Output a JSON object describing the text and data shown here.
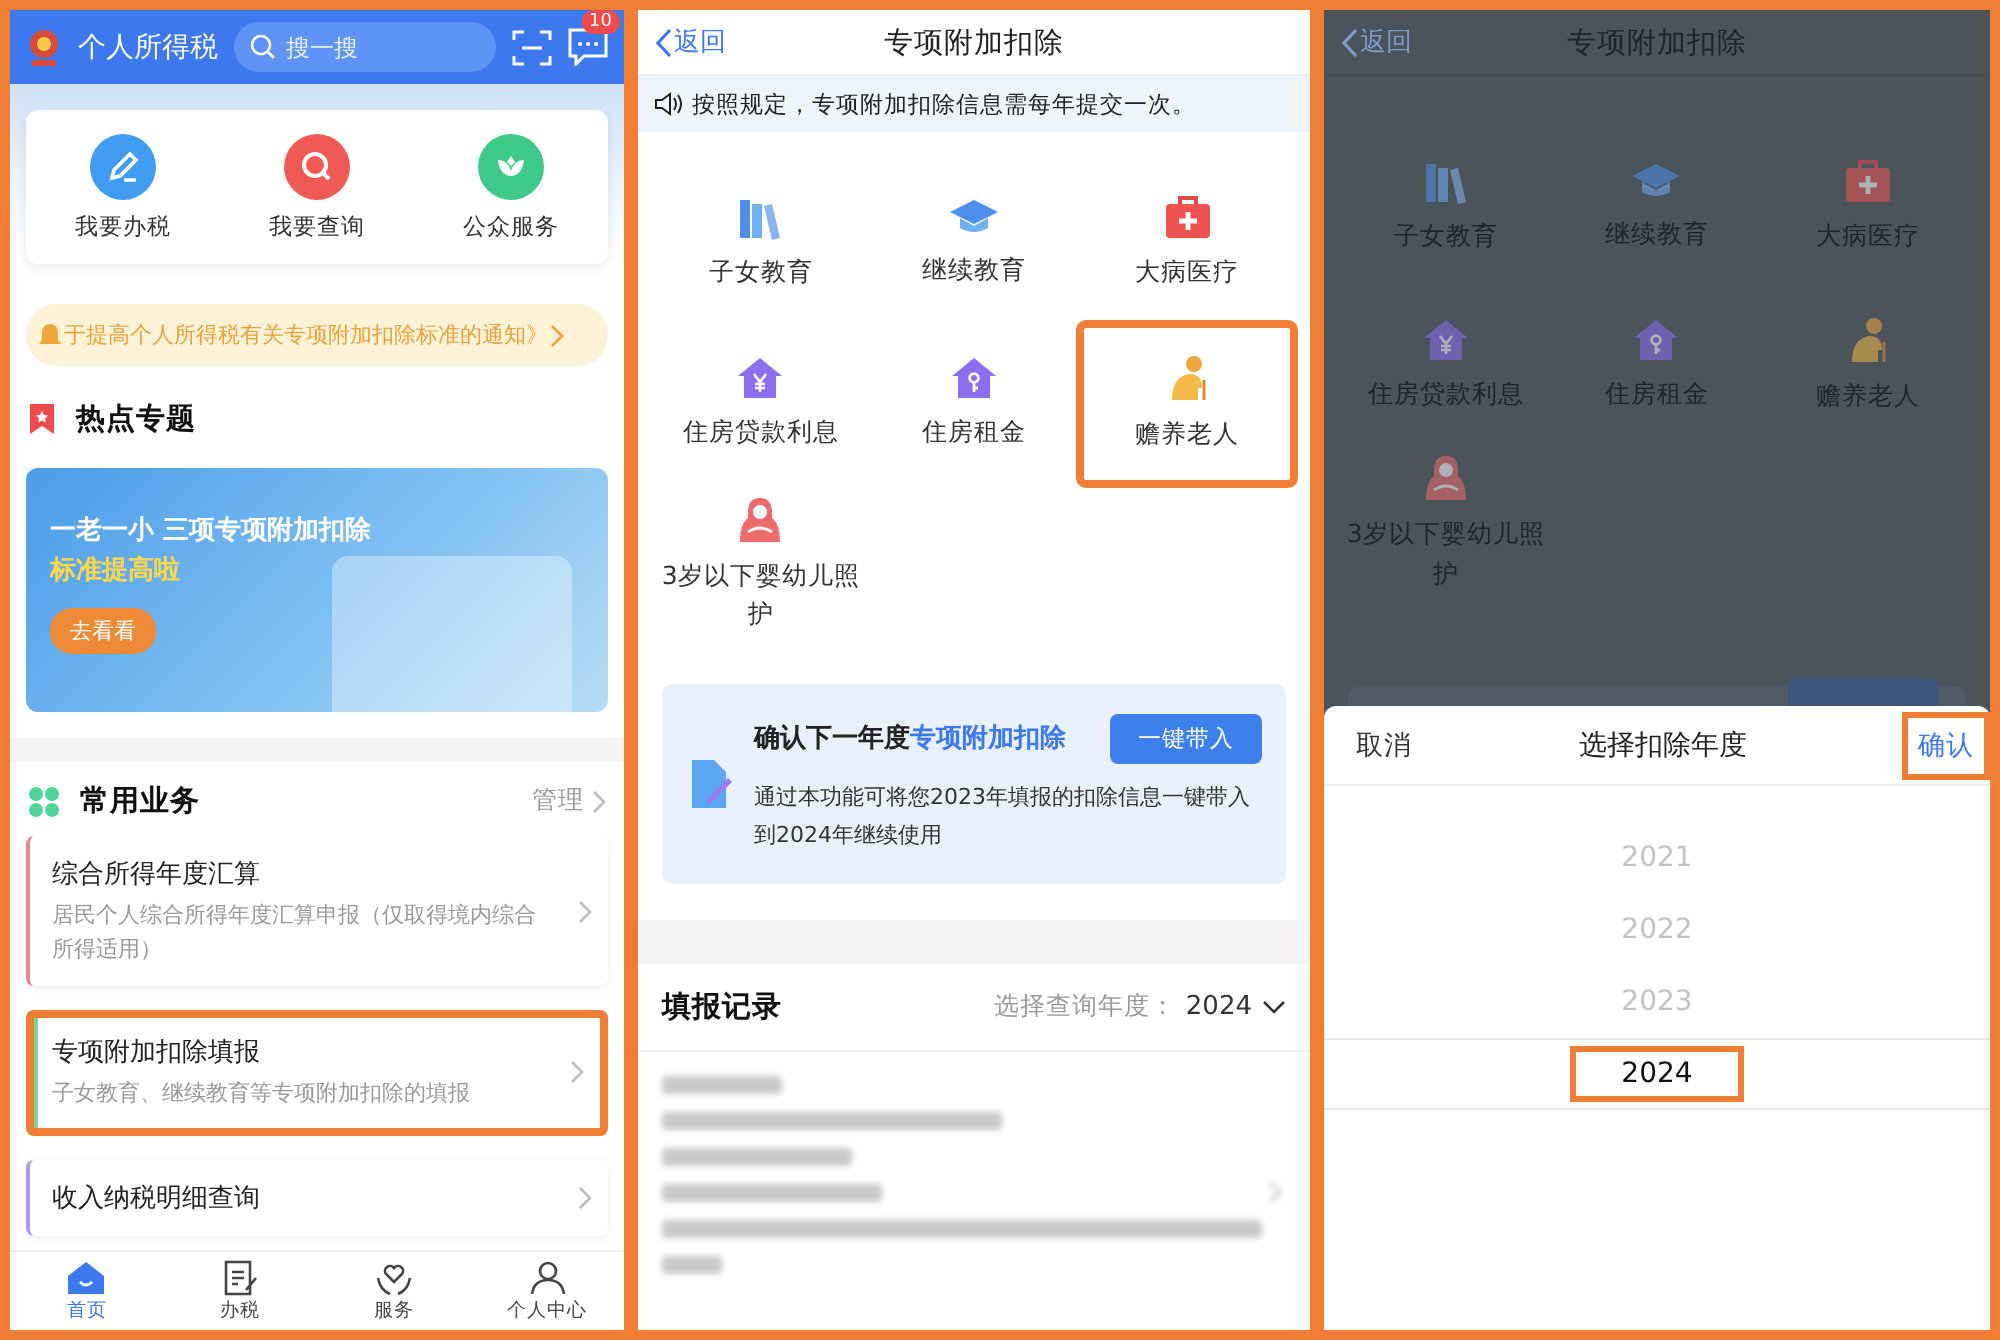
{
  "home": {
    "app_title": "个人所得税",
    "search": {
      "placeholder": "搜一搜"
    },
    "message_badge": "10",
    "quick_actions": [
      {
        "label": "我要办税",
        "kind": "tax"
      },
      {
        "label": "我要查询",
        "kind": "query"
      },
      {
        "label": "公众服务",
        "kind": "service"
      }
    ],
    "notice": "于提高个人所得税有关专项附加扣除标准的通知》",
    "hot_topics": {
      "title": "热点专题",
      "banner": {
        "headline": "一老一小 三项专项附加扣除",
        "subheadline": "标准提高啦",
        "button": "去看看"
      }
    },
    "common": {
      "title": "常用业务",
      "manage": "管理"
    },
    "services": [
      {
        "title": "综合所得年度汇算",
        "desc": "居民个人综合所得年度汇算申报（仅取得境内综合所得适用）",
        "color": "#e5879b",
        "highlighted": false
      },
      {
        "title": "专项附加扣除填报",
        "desc": "子女教育、继续教育等专项附加扣除的填报",
        "color": "#7fd3a0",
        "highlighted": true
      },
      {
        "title": "收入纳税明细查询",
        "color": "#a99ae6",
        "highlighted": false
      }
    ],
    "nav": [
      {
        "label": "首页",
        "kind": "home",
        "selected": true
      },
      {
        "label": "办税",
        "kind": "tax",
        "selected": false
      },
      {
        "label": "服务",
        "kind": "service",
        "selected": false
      },
      {
        "label": "个人中心",
        "kind": "user",
        "selected": false
      }
    ]
  },
  "deduction": {
    "back": "返回",
    "title": "专项附加扣除",
    "notice": "按照规定，专项附加扣除信息需每年提交一次。",
    "items": [
      {
        "label": "子女教育",
        "kind": "children",
        "highlighted": false
      },
      {
        "label": "继续教育",
        "kind": "education",
        "highlighted": false
      },
      {
        "label": "大病医疗",
        "kind": "medical",
        "highlighted": false
      },
      {
        "label": "住房贷款利息",
        "kind": "mortgage",
        "highlighted": false
      },
      {
        "label": "住房租金",
        "kind": "rent",
        "highlighted": false
      },
      {
        "label": "赡养老人",
        "kind": "elderly",
        "highlighted": true
      },
      {
        "label": "3岁以下婴幼儿照护",
        "kind": "infant",
        "highlighted": false
      }
    ],
    "confirm_card": {
      "title": "确认下一年度",
      "title_link": "专项附加扣除",
      "button": "一键带入",
      "desc": "通过本功能可将您2023年填报的扣除信息一键带入到2024年继续使用"
    },
    "records": {
      "title": "填报记录",
      "year_label": "选择查询年度：",
      "year": "2024"
    }
  },
  "year_picker": {
    "background": {
      "back": "返回",
      "title": "专项附加扣除",
      "items": [
        {
          "label": "子女教育",
          "kind": "children"
        },
        {
          "label": "继续教育",
          "kind": "education"
        },
        {
          "label": "大病医疗",
          "kind": "medical"
        },
        {
          "label": "住房贷款利息",
          "kind": "mortgage"
        },
        {
          "label": "住房租金",
          "kind": "rent"
        },
        {
          "label": "赡养老人",
          "kind": "elderly"
        },
        {
          "label": "3岁以下婴幼儿照护",
          "kind": "infant"
        }
      ]
    },
    "cancel": "取消",
    "title": "选择扣除年度",
    "confirm": "确认",
    "confirm_highlighted": true,
    "years": [
      {
        "label": "2021",
        "selected": false
      },
      {
        "label": "2022",
        "selected": false
      },
      {
        "label": "2023",
        "selected": false
      },
      {
        "label": "2024",
        "selected": true
      }
    ]
  }
}
